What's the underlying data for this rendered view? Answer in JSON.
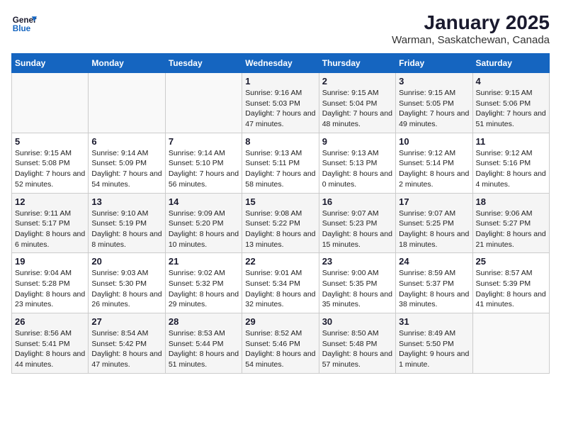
{
  "logo": {
    "line1": "General",
    "line2": "Blue"
  },
  "title": "January 2025",
  "subtitle": "Warman, Saskatchewan, Canada",
  "days_header": [
    "Sunday",
    "Monday",
    "Tuesday",
    "Wednesday",
    "Thursday",
    "Friday",
    "Saturday"
  ],
  "weeks": [
    {
      "days": [
        {
          "num": "",
          "info": ""
        },
        {
          "num": "",
          "info": ""
        },
        {
          "num": "",
          "info": ""
        },
        {
          "num": "1",
          "info": "Sunrise: 9:16 AM\nSunset: 5:03 PM\nDaylight: 7 hours and 47 minutes."
        },
        {
          "num": "2",
          "info": "Sunrise: 9:15 AM\nSunset: 5:04 PM\nDaylight: 7 hours and 48 minutes."
        },
        {
          "num": "3",
          "info": "Sunrise: 9:15 AM\nSunset: 5:05 PM\nDaylight: 7 hours and 49 minutes."
        },
        {
          "num": "4",
          "info": "Sunrise: 9:15 AM\nSunset: 5:06 PM\nDaylight: 7 hours and 51 minutes."
        }
      ]
    },
    {
      "days": [
        {
          "num": "5",
          "info": "Sunrise: 9:15 AM\nSunset: 5:08 PM\nDaylight: 7 hours and 52 minutes."
        },
        {
          "num": "6",
          "info": "Sunrise: 9:14 AM\nSunset: 5:09 PM\nDaylight: 7 hours and 54 minutes."
        },
        {
          "num": "7",
          "info": "Sunrise: 9:14 AM\nSunset: 5:10 PM\nDaylight: 7 hours and 56 minutes."
        },
        {
          "num": "8",
          "info": "Sunrise: 9:13 AM\nSunset: 5:11 PM\nDaylight: 7 hours and 58 minutes."
        },
        {
          "num": "9",
          "info": "Sunrise: 9:13 AM\nSunset: 5:13 PM\nDaylight: 8 hours and 0 minutes."
        },
        {
          "num": "10",
          "info": "Sunrise: 9:12 AM\nSunset: 5:14 PM\nDaylight: 8 hours and 2 minutes."
        },
        {
          "num": "11",
          "info": "Sunrise: 9:12 AM\nSunset: 5:16 PM\nDaylight: 8 hours and 4 minutes."
        }
      ]
    },
    {
      "days": [
        {
          "num": "12",
          "info": "Sunrise: 9:11 AM\nSunset: 5:17 PM\nDaylight: 8 hours and 6 minutes."
        },
        {
          "num": "13",
          "info": "Sunrise: 9:10 AM\nSunset: 5:19 PM\nDaylight: 8 hours and 8 minutes."
        },
        {
          "num": "14",
          "info": "Sunrise: 9:09 AM\nSunset: 5:20 PM\nDaylight: 8 hours and 10 minutes."
        },
        {
          "num": "15",
          "info": "Sunrise: 9:08 AM\nSunset: 5:22 PM\nDaylight: 8 hours and 13 minutes."
        },
        {
          "num": "16",
          "info": "Sunrise: 9:07 AM\nSunset: 5:23 PM\nDaylight: 8 hours and 15 minutes."
        },
        {
          "num": "17",
          "info": "Sunrise: 9:07 AM\nSunset: 5:25 PM\nDaylight: 8 hours and 18 minutes."
        },
        {
          "num": "18",
          "info": "Sunrise: 9:06 AM\nSunset: 5:27 PM\nDaylight: 8 hours and 21 minutes."
        }
      ]
    },
    {
      "days": [
        {
          "num": "19",
          "info": "Sunrise: 9:04 AM\nSunset: 5:28 PM\nDaylight: 8 hours and 23 minutes."
        },
        {
          "num": "20",
          "info": "Sunrise: 9:03 AM\nSunset: 5:30 PM\nDaylight: 8 hours and 26 minutes."
        },
        {
          "num": "21",
          "info": "Sunrise: 9:02 AM\nSunset: 5:32 PM\nDaylight: 8 hours and 29 minutes."
        },
        {
          "num": "22",
          "info": "Sunrise: 9:01 AM\nSunset: 5:34 PM\nDaylight: 8 hours and 32 minutes."
        },
        {
          "num": "23",
          "info": "Sunrise: 9:00 AM\nSunset: 5:35 PM\nDaylight: 8 hours and 35 minutes."
        },
        {
          "num": "24",
          "info": "Sunrise: 8:59 AM\nSunset: 5:37 PM\nDaylight: 8 hours and 38 minutes."
        },
        {
          "num": "25",
          "info": "Sunrise: 8:57 AM\nSunset: 5:39 PM\nDaylight: 8 hours and 41 minutes."
        }
      ]
    },
    {
      "days": [
        {
          "num": "26",
          "info": "Sunrise: 8:56 AM\nSunset: 5:41 PM\nDaylight: 8 hours and 44 minutes."
        },
        {
          "num": "27",
          "info": "Sunrise: 8:54 AM\nSunset: 5:42 PM\nDaylight: 8 hours and 47 minutes."
        },
        {
          "num": "28",
          "info": "Sunrise: 8:53 AM\nSunset: 5:44 PM\nDaylight: 8 hours and 51 minutes."
        },
        {
          "num": "29",
          "info": "Sunrise: 8:52 AM\nSunset: 5:46 PM\nDaylight: 8 hours and 54 minutes."
        },
        {
          "num": "30",
          "info": "Sunrise: 8:50 AM\nSunset: 5:48 PM\nDaylight: 8 hours and 57 minutes."
        },
        {
          "num": "31",
          "info": "Sunrise: 8:49 AM\nSunset: 5:50 PM\nDaylight: 9 hours and 1 minute."
        },
        {
          "num": "",
          "info": ""
        }
      ]
    }
  ]
}
